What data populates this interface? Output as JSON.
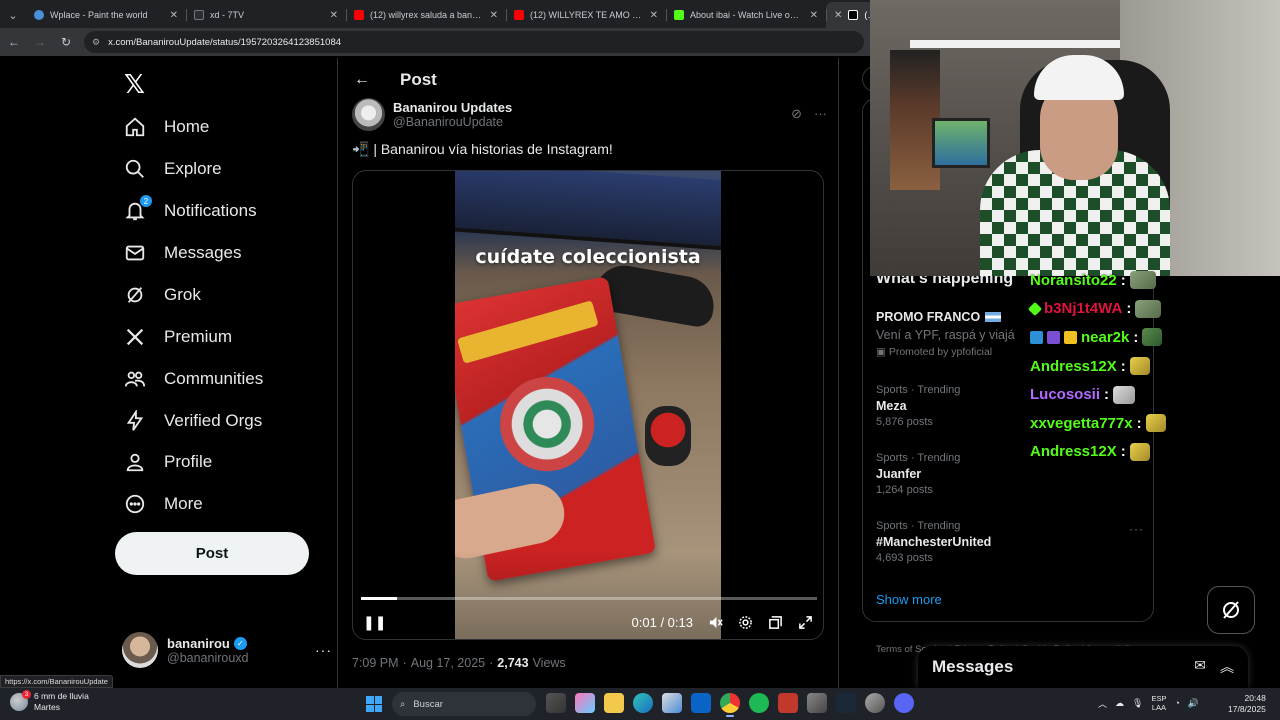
{
  "browser": {
    "tabs": [
      {
        "title": "Wplace - Paint the world",
        "color": "#4a90d9"
      },
      {
        "title": "xd - 7TV",
        "color": "#2a2d33"
      },
      {
        "title": "(12) willyrex saluda a bana - You",
        "color": "#ff0000"
      },
      {
        "title": "(12) WILLYREX TE AMO - YouTu",
        "color": "#ff0000"
      },
      {
        "title": "About ibai - Watch Live on Kick",
        "color": "#53fc18"
      },
      {
        "title": "(2) Bana",
        "color": "#000000"
      }
    ],
    "url": "x.com/BananirouUpdate/status/1957203264123851084",
    "status_url": "https://x.com/BananirouUpdate"
  },
  "nav": {
    "items": [
      {
        "label": "Home",
        "icon": "home-icon"
      },
      {
        "label": "Explore",
        "icon": "search-icon"
      },
      {
        "label": "Notifications",
        "icon": "bell-icon",
        "badge": "2"
      },
      {
        "label": "Messages",
        "icon": "envelope-icon"
      },
      {
        "label": "Grok",
        "icon": "grok-icon"
      },
      {
        "label": "Premium",
        "icon": "x-logo-icon"
      },
      {
        "label": "Communities",
        "icon": "people-icon"
      },
      {
        "label": "Verified Orgs",
        "icon": "lightning-icon"
      },
      {
        "label": "Profile",
        "icon": "person-icon"
      },
      {
        "label": "More",
        "icon": "more-circle-icon"
      }
    ],
    "post_button": "Post",
    "account": {
      "name": "bananirou",
      "handle": "@bananirouxd"
    }
  },
  "main": {
    "header_title": "Post",
    "author": {
      "name": "Bananirou Updates",
      "handle": "@BananirouUpdate"
    },
    "text": "📲 | Bananirou vía historias de Instagram!",
    "video": {
      "caption": "cuídate coleccionista",
      "time": "0:01 / 0:13",
      "progress": 0.08
    },
    "meta": {
      "time": "7:09 PM",
      "date": "Aug 17, 2025",
      "views_count": "2,743",
      "views_label": "Views"
    }
  },
  "sidebar": {
    "heading": "What's happening",
    "promo": {
      "title": "PROMO FRANCO",
      "desc": "Vení a YPF, raspá y viajá",
      "promoted_by": "Promoted by ypfoficial"
    },
    "trends": [
      {
        "category": "Sports · Trending",
        "name": "Meza",
        "count": "5,876 posts"
      },
      {
        "category": "Sports · Trending",
        "name": "Juanfer",
        "count": "1,264 posts"
      },
      {
        "category": "Sports · Trending",
        "name": "#ManchesterUnited",
        "count": "4,693 posts"
      }
    ],
    "show_more": "Show more",
    "footer": "Terms of Service | Privacy Policy | Cookie Policy | Accessibility"
  },
  "messages_drawer": {
    "title": "Messages"
  },
  "chat": [
    {
      "user": "Noransito22",
      "color": "#53fc18",
      "emote": "emote"
    },
    {
      "user": "b3Nj1t4WA",
      "color": "#e0143c",
      "emote": "emote"
    },
    {
      "user": "near2k",
      "color": "#53fc18",
      "emote": "g"
    },
    {
      "user": "Andress12X",
      "color": "#53fc18",
      "emote": "y"
    },
    {
      "user": "Lucososii",
      "color": "#b36bff",
      "emote": "w"
    },
    {
      "user": "xxvegetta777x",
      "color": "#53fc18",
      "emote": "y"
    },
    {
      "user": "Andress12X",
      "color": "#53fc18",
      "emote": "y"
    }
  ],
  "taskbar": {
    "weather_temp": "6 mm de lluvia",
    "weather_day": "Martes",
    "weather_badge": "3",
    "search_placeholder": "Buscar",
    "lang_top": "ESP",
    "lang_bottom": "LAA",
    "time": "20:48",
    "date": "17/8/2025"
  }
}
